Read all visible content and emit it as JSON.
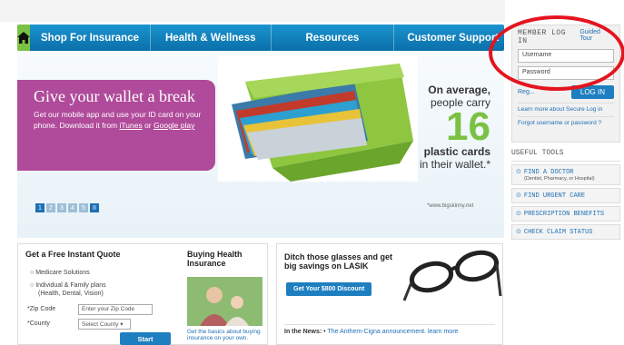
{
  "nav": {
    "items": [
      "Shop For Insurance",
      "Health & Wellness",
      "Resources",
      "Customer Support"
    ]
  },
  "hero": {
    "promo_title": "Give your wallet a break",
    "promo_text": "Get our mobile app and use your ID card on your phone. Download it from",
    "itunes": "iTunes",
    "or": " or ",
    "google_play": "Google play",
    "stat_line1": "On average,",
    "stat_line2": "people carry",
    "stat_number": "16",
    "stat_line3": "plastic cards",
    "stat_line4": "in their wallet.*",
    "credit": "*www.bigskinny.net",
    "pager": [
      "1",
      "2",
      "3",
      "4",
      "5",
      "II"
    ]
  },
  "login": {
    "title": "MEMBER LOG IN",
    "guided_tour": "Guided Tour",
    "username_placeholder": "Username",
    "password_placeholder": "Password",
    "register": "Reg...",
    "login_button": "LOG IN",
    "secure_link": "Learn more about Secure Log in",
    "forgot": "Forgot username or password ?"
  },
  "tools": {
    "title": "USEFUL TOOLS",
    "items": [
      {
        "label": "FIND A DOCTOR",
        "sub": "(Dentist, Pharmacy, or Hospital)"
      },
      {
        "label": "FIND URGENT CARE",
        "sub": ""
      },
      {
        "label": "PRESCRIPTION BENEFITS",
        "sub": ""
      },
      {
        "label": "CHECK CLAIM STATUS",
        "sub": ""
      }
    ]
  },
  "quote": {
    "title": "Get a Free Instant Quote",
    "opt1": "Medicare Solutions",
    "opt2": "Individual & Family plans",
    "opt2_sub": "(Health, Dental, Vision)",
    "zip_label": "*Zip Code",
    "zip_placeholder": "Enter your Zip Code",
    "county_label": "*County",
    "county_value": "Select County",
    "start": "Start"
  },
  "buying": {
    "title": "Buying Health Insurance",
    "text": "Get the basics about buying insurance on your own."
  },
  "lasik": {
    "title": "Ditch those glasses and get big savings on LASIK",
    "button": "Get Your $800 Discount",
    "news_label": "In the News:",
    "news_text": "The Anthem-Cigna announcement. learn more"
  },
  "colors": {
    "nav_blue": "#0b6fa9",
    "home_green": "#7bc143",
    "promo_purple": "#b04a9a",
    "highlight_red": "#e4141e"
  }
}
